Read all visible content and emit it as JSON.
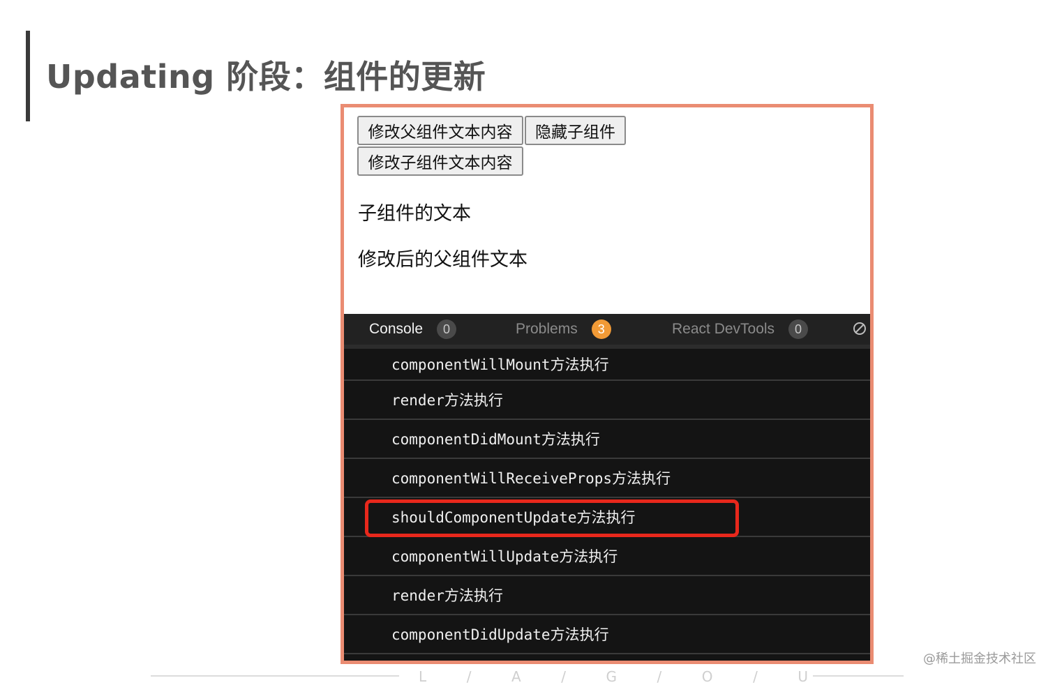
{
  "slide": {
    "title": "Updating 阶段：组件的更新"
  },
  "app": {
    "buttons": {
      "modify_parent_text": "修改父组件文本内容",
      "hide_child": "隐藏子组件",
      "modify_child_text": "修改子组件文本内容"
    },
    "child_text": "子组件的文本",
    "parent_text": "修改后的父组件文本"
  },
  "devtools": {
    "tabs": [
      {
        "label": "Console",
        "count": "0",
        "active": true
      },
      {
        "label": "Problems",
        "count": "3",
        "active": false
      },
      {
        "label": "React DevTools",
        "count": "0",
        "active": false
      }
    ],
    "logs": [
      "componentWillMount方法执行",
      "render方法执行",
      "componentDidMount方法执行",
      "componentWillReceiveProps方法执行",
      "shouldComponentUpdate方法执行",
      "componentWillUpdate方法执行",
      "render方法执行",
      "componentDidUpdate方法执行"
    ],
    "highlighted_log_index": 3
  },
  "footer": {
    "brand_letters": [
      "L",
      "/",
      "A",
      "/",
      "G",
      "/",
      "O",
      "/",
      "U"
    ]
  },
  "watermark": "@稀土掘金技术社区",
  "colors": {
    "frame_border": "#ea8c72",
    "highlight_border": "#e8281c",
    "warning_badge": "#f19a36",
    "console_bg": "#141414"
  }
}
